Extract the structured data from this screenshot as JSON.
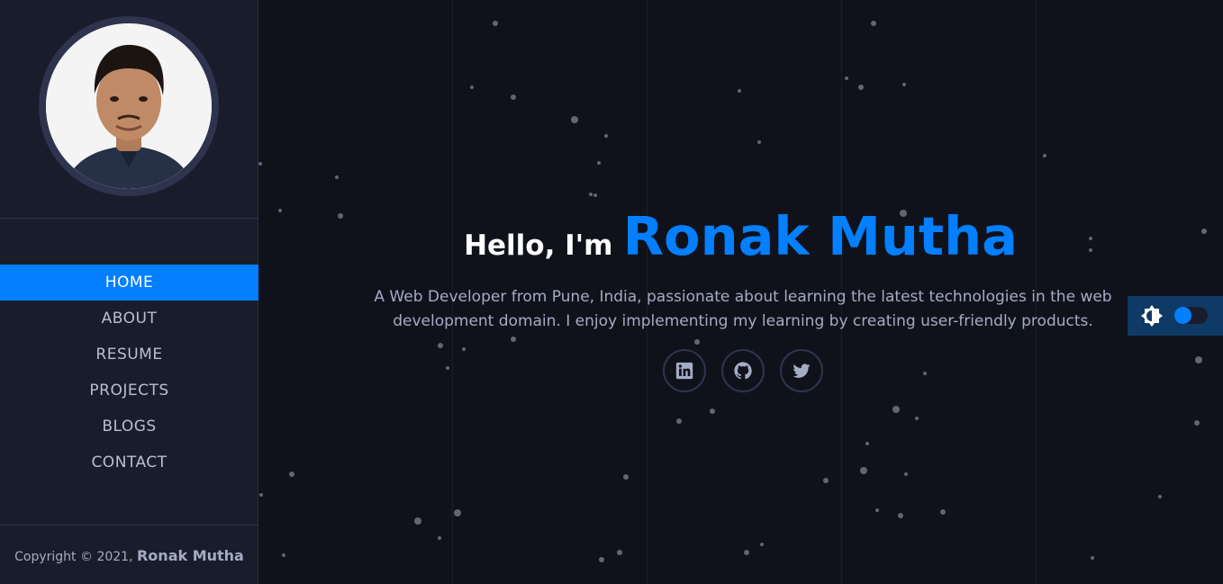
{
  "sidebar": {
    "avatar_alt": "Ronak Mutha",
    "nav": [
      {
        "label": "HOME",
        "active": true
      },
      {
        "label": "ABOUT",
        "active": false
      },
      {
        "label": "RESUME",
        "active": false
      },
      {
        "label": "PROJECTS",
        "active": false
      },
      {
        "label": "BLOGS",
        "active": false
      },
      {
        "label": "CONTACT",
        "active": false
      }
    ],
    "copyright_prefix": "Copyright © 2021,",
    "copyright_name": "Ronak Mutha"
  },
  "hero": {
    "greeting": "Hello, I'm",
    "name": "Ronak Mutha",
    "description": "A Web Developer from Pune, India, passionate about learning the latest technologies in the web development domain. I enjoy implementing my learning by creating user-friendly products.",
    "socials": [
      {
        "icon": "linkedin-icon"
      },
      {
        "icon": "github-icon"
      },
      {
        "icon": "twitter-icon"
      }
    ]
  },
  "theme_toggle": {
    "icon": "sun-icon",
    "state": "dark"
  },
  "colors": {
    "accent": "#037fff",
    "background": "#10121b",
    "sidebar": "#191d2b",
    "text_muted": "#a4acc4",
    "border": "#2e344e"
  }
}
